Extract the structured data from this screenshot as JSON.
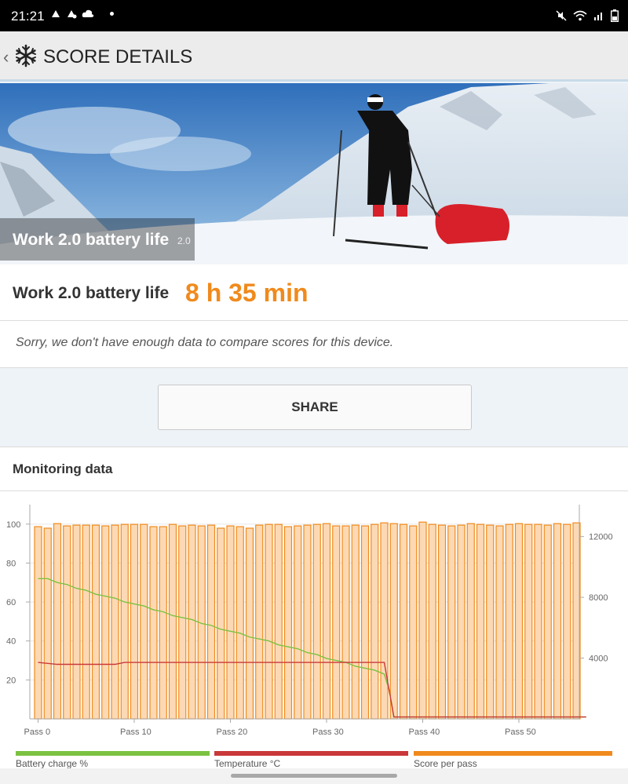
{
  "status_bar": {
    "time": "21:21"
  },
  "header": {
    "title": "SCORE DETAILS"
  },
  "hero": {
    "title": "Work 2.0 battery life",
    "version": "2.0"
  },
  "score": {
    "label": "Work 2.0 battery life",
    "value": "8 h 35 min"
  },
  "compare": {
    "message": "Sorry, we don't have enough data to compare scores for this device."
  },
  "share": {
    "label": "SHARE"
  },
  "monitoring": {
    "title": "Monitoring data"
  },
  "colors": {
    "accent": "#f08a1c",
    "battery": "#7cc242",
    "temperature": "#c9383a",
    "score_bar": "#f08a1c"
  },
  "chart_data": {
    "type": "bar",
    "x_ticks": [
      "Pass 0",
      "Pass 10",
      "Pass 20",
      "Pass 30",
      "Pass 40",
      "Pass 50"
    ],
    "x_tick_positions": [
      0,
      10,
      20,
      30,
      40,
      50
    ],
    "y_left_ticks": [
      "100",
      "80",
      "60",
      "40",
      "20"
    ],
    "y_left_tick_values": [
      100,
      80,
      60,
      40,
      20
    ],
    "y_left_range": [
      0,
      110
    ],
    "y_right_ticks": [
      "12000",
      "8000",
      "4000"
    ],
    "y_right_tick_values": [
      12000,
      8000,
      4000
    ],
    "y_right_range": [
      0,
      14100
    ],
    "series": [
      {
        "name": "Score per pass",
        "type": "bar",
        "axis": "right",
        "values": [
          12650,
          12550,
          12850,
          12700,
          12750,
          12750,
          12750,
          12700,
          12750,
          12800,
          12800,
          12800,
          12650,
          12650,
          12800,
          12700,
          12750,
          12700,
          12750,
          12550,
          12700,
          12650,
          12550,
          12750,
          12800,
          12800,
          12650,
          12700,
          12750,
          12800,
          12850,
          12700,
          12700,
          12750,
          12700,
          12800,
          12900,
          12850,
          12800,
          12700,
          12950,
          12800,
          12750,
          12700,
          12750,
          12850,
          12800,
          12750,
          12700,
          12800,
          12850,
          12800,
          12800,
          12750,
          12850,
          12800,
          12900
        ]
      },
      {
        "name": "Battery charge %",
        "type": "line",
        "axis": "left",
        "x": [
          0,
          1,
          2,
          3,
          4,
          5,
          6,
          7,
          8,
          9,
          10,
          11,
          12,
          13,
          14,
          15,
          16,
          17,
          18,
          19,
          20,
          21,
          22,
          23,
          24,
          25,
          26,
          27,
          28,
          29,
          30,
          31,
          32,
          33,
          34,
          35,
          36,
          36.5,
          37,
          38,
          39,
          40,
          41,
          42,
          43,
          44,
          45,
          46,
          47,
          48,
          49,
          50,
          51,
          52,
          53,
          54,
          55,
          56,
          57
        ],
        "values": [
          72,
          72,
          70,
          69,
          67,
          66,
          64,
          63,
          62,
          60,
          59,
          58,
          56,
          55,
          53,
          52,
          51,
          49,
          48,
          46,
          45,
          44,
          42,
          41,
          40,
          38,
          37,
          36,
          34,
          33,
          31,
          30,
          29,
          27,
          26,
          25,
          23,
          15,
          1,
          1,
          1,
          1,
          1,
          1,
          1,
          1,
          1,
          1,
          1,
          1,
          1,
          1,
          1,
          1,
          1,
          1,
          1,
          1,
          1
        ]
      },
      {
        "name": "Temperature °C",
        "type": "line",
        "axis": "left",
        "x": [
          0,
          2,
          8,
          9,
          36,
          37,
          57
        ],
        "values": [
          29,
          28,
          28,
          29,
          29,
          1,
          1
        ]
      }
    ]
  }
}
